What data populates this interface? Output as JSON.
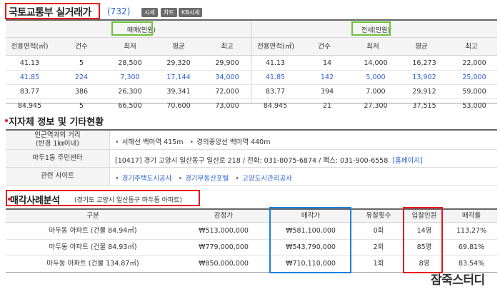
{
  "header": {
    "title": "국토교통부 실거래가",
    "count": "(732)",
    "tags": [
      "시세",
      "차트",
      "KB시세"
    ]
  },
  "price_table": {
    "sale_label": "매매(만원)",
    "jeonse_label": "전세(만원)",
    "columns": [
      "전용면적(㎡)",
      "건수",
      "최저",
      "평균",
      "최고"
    ],
    "sale_rows": [
      [
        "41.13",
        "5",
        "28,500",
        "29,320",
        "29,900"
      ],
      [
        "41.85",
        "224",
        "7,300",
        "17,144",
        "34,000"
      ],
      [
        "83.77",
        "386",
        "26,300",
        "39,341",
        "72,000"
      ],
      [
        "84.945",
        "5",
        "66,500",
        "70,600",
        "73,000"
      ]
    ],
    "jeonse_rows": [
      [
        "41.13",
        "14",
        "14,000",
        "16,273",
        "22,000"
      ],
      [
        "41.85",
        "142",
        "5,000",
        "13,902",
        "25,000"
      ],
      [
        "83.77",
        "394",
        "7,000",
        "29,912",
        "59,000"
      ],
      [
        "84.945",
        "21",
        "27,300",
        "37,515",
        "53,000"
      ]
    ],
    "highlight_color": "#2b5fcf"
  },
  "local_info": {
    "title": "지자체 정보 및 기타현황",
    "rows": [
      {
        "head1": "인근역과의 거리",
        "head2": "(반경 1㎞이내)",
        "items": [
          "서해선 백마역 415m",
          "경의중앙선 백마역 440m"
        ]
      },
      {
        "head1": "마두1동 주민센터",
        "text": "[10417] 경기 고양시 일산동구 일산로 218 / 전화: 031-8075-6874 / 팩스: 031-900-6558",
        "link": "[홈페이지]"
      },
      {
        "head1": "관련 사이트",
        "links": [
          "경기주택도시공사",
          "경기부동산포털",
          "고양도시관리공사"
        ]
      }
    ]
  },
  "auction": {
    "title": "매각사례분석",
    "subtitle": "(경기도 고양시 일산동구 마두동 아파트)",
    "columns": [
      "구분",
      "감정가",
      "매각가",
      "유찰횟수",
      "입찰인원",
      "매각율"
    ],
    "rows": [
      [
        "마두동 아파트 (건물 84.94㎡)",
        "₩513,000,000",
        "₩581,100,000",
        "0회",
        "14명",
        "113.27%"
      ],
      [
        "마두동 아파트 (건물 84.93㎡)",
        "₩779,000,000",
        "₩543,790,000",
        "2회",
        "85명",
        "69.81%"
      ],
      [
        "마두동 아파트 (건물 134.87㎡)",
        "₩850,000,000",
        "₩710,110,000",
        "1회",
        "8명",
        "83.54%"
      ]
    ]
  },
  "watermark": "잠죽스터디"
}
